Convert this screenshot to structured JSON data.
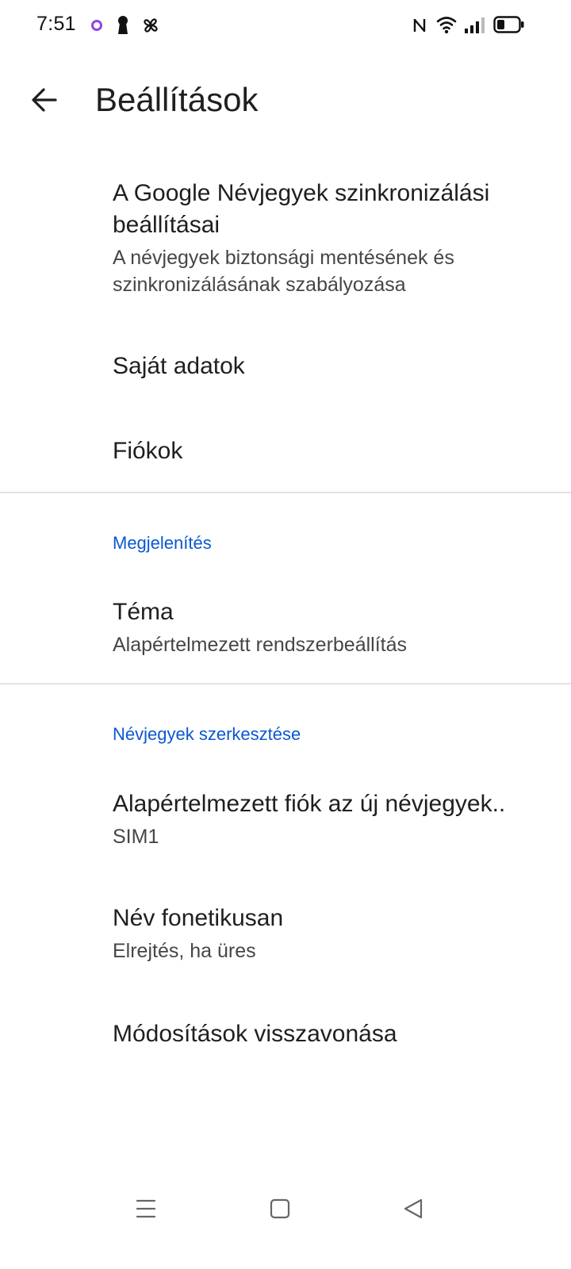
{
  "status_bar": {
    "time": "7:51",
    "left_icons": [
      "circle-notification-icon",
      "keyhole-icon",
      "fan-icon"
    ],
    "right_icons": [
      "nfc-icon",
      "wifi-icon",
      "signal-icon",
      "battery-icon"
    ]
  },
  "app_bar": {
    "title": "Beállítások",
    "back_icon": "arrow-back-icon"
  },
  "items": {
    "sync": {
      "title": "A Google Névjegyek szinkronizálási beállításai",
      "summary": "A névjegyek biztonsági mentésének és szinkronizálásának szabályozása"
    },
    "my_info": {
      "title": "Saját adatok"
    },
    "accounts": {
      "title": "Fiókok"
    },
    "theme": {
      "title": "Téma",
      "summary": "Alapértelmezett rendszerbeállítás"
    },
    "default_account": {
      "title": "Alapértelmezett fiók az új névjegyek..",
      "summary": "SIM1"
    },
    "phonetic_name": {
      "title": "Név fonetikusan",
      "summary": "Elrejtés, ha üres"
    },
    "undo_changes": {
      "title": "Módosítások visszavonása"
    }
  },
  "sections": {
    "display": "Megjelenítés",
    "editing": "Névjegyek szerkesztése"
  },
  "nav_bar": {
    "icons": [
      "menu-icon",
      "home-square-icon",
      "back-triangle-icon"
    ]
  },
  "colors": {
    "accent": "#0b57d0",
    "text_primary": "#1f1f1f",
    "text_secondary": "#444746",
    "divider": "#e3e3e3",
    "status_dot": "#8e44e8"
  }
}
